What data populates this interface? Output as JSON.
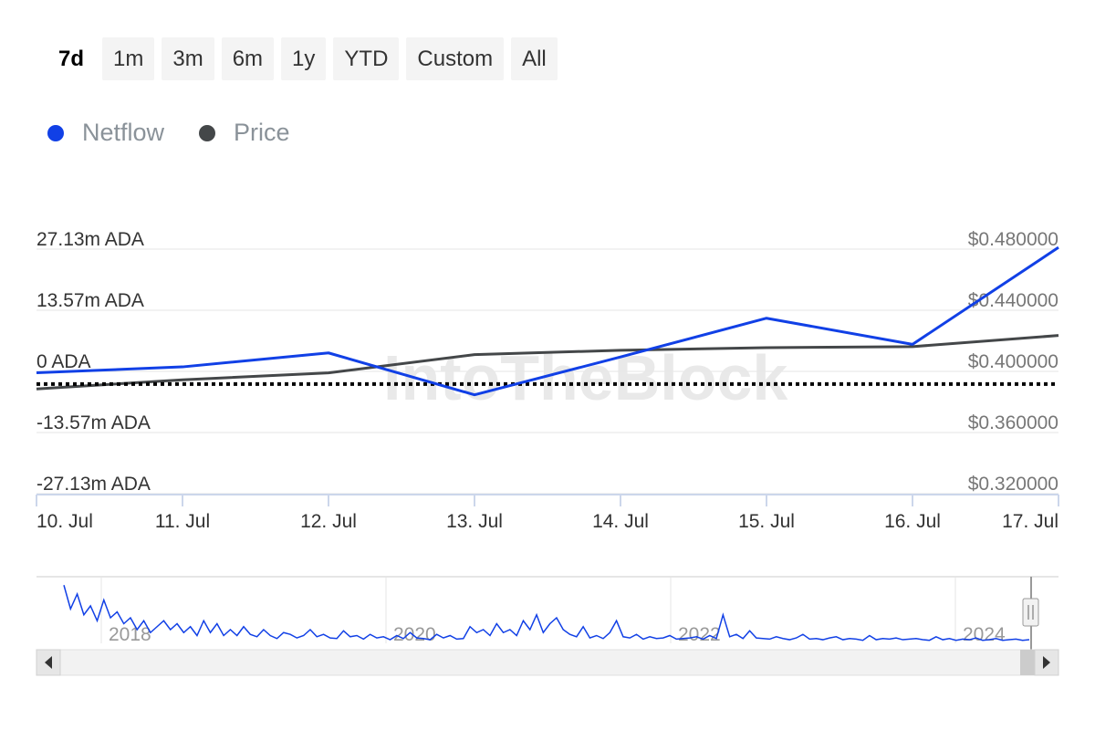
{
  "toolbar": {
    "ranges": [
      {
        "label": "7d",
        "active": true
      },
      {
        "label": "1m"
      },
      {
        "label": "3m"
      },
      {
        "label": "6m"
      },
      {
        "label": "1y"
      },
      {
        "label": "YTD"
      },
      {
        "label": "Custom"
      },
      {
        "label": "All"
      }
    ]
  },
  "legend": [
    {
      "label": "Netflow",
      "color": "#1140e6"
    },
    {
      "label": "Price",
      "color": "#444749"
    }
  ],
  "watermark": "IntoTheBlock",
  "chart_data": {
    "type": "line",
    "x": [
      "10. Jul",
      "11. Jul",
      "12. Jul",
      "13. Jul",
      "14. Jul",
      "15. Jul",
      "16. Jul",
      "17. Jul"
    ],
    "x_index": [
      0,
      1,
      2,
      3,
      4,
      5,
      6,
      7
    ],
    "series": [
      {
        "name": "Netflow",
        "axis": "left",
        "color": "#1140e6",
        "values": [
          -0.3,
          1.0,
          4.1,
          -5.2,
          3.2,
          11.8,
          6.0,
          27.5
        ]
      },
      {
        "name": "Price",
        "axis": "right",
        "color": "#444749",
        "values": [
          0.3885,
          0.3945,
          0.399,
          0.411,
          0.4138,
          0.4155,
          0.4162,
          0.4235
        ]
      }
    ],
    "left_axis": {
      "ticks": [
        "27.13m ADA",
        "13.57m ADA",
        "0 ADA",
        "-13.57m ADA",
        "-27.13m ADA"
      ],
      "values": [
        27.13,
        13.57,
        0,
        -13.57,
        -27.13
      ],
      "ylim": [
        -27.13,
        27.13
      ]
    },
    "right_axis": {
      "ticks": [
        "$0.480000",
        "$0.440000",
        "$0.400000",
        "$0.360000",
        "$0.320000"
      ],
      "values": [
        0.48,
        0.44,
        0.4,
        0.36,
        0.32
      ],
      "ylim": [
        0.32,
        0.48
      ]
    },
    "zero_line": {
      "style": "dotted",
      "color": "#000000",
      "value": -2.8
    },
    "grid": true,
    "navigator": {
      "year_labels": [
        "2018",
        "2020",
        "2022",
        "2024"
      ],
      "series": [
        0.95,
        0.55,
        0.8,
        0.45,
        0.6,
        0.35,
        0.7,
        0.4,
        0.5,
        0.3,
        0.4,
        0.2,
        0.35,
        0.15,
        0.25,
        0.35,
        0.2,
        0.3,
        0.15,
        0.25,
        0.1,
        0.35,
        0.15,
        0.3,
        0.1,
        0.2,
        0.1,
        0.25,
        0.12,
        0.08,
        0.2,
        0.1,
        0.05,
        0.15,
        0.12,
        0.06,
        0.1,
        0.2,
        0.08,
        0.12,
        0.06,
        0.05,
        0.18,
        0.08,
        0.1,
        0.04,
        0.12,
        0.06,
        0.08,
        0.03,
        0.1,
        0.05,
        0.15,
        0.06,
        0.05,
        0.03,
        0.12,
        0.06,
        0.1,
        0.04,
        0.05,
        0.25,
        0.15,
        0.2,
        0.1,
        0.3,
        0.15,
        0.2,
        0.1,
        0.35,
        0.2,
        0.45,
        0.15,
        0.3,
        0.4,
        0.2,
        0.12,
        0.08,
        0.25,
        0.06,
        0.1,
        0.05,
        0.15,
        0.35,
        0.08,
        0.06,
        0.12,
        0.04,
        0.08,
        0.05,
        0.06,
        0.1,
        0.04,
        0.05,
        0.06,
        0.08,
        0.04,
        0.1,
        0.05,
        0.45,
        0.08,
        0.12,
        0.05,
        0.18,
        0.06,
        0.05,
        0.04,
        0.08,
        0.05,
        0.03,
        0.06,
        0.12,
        0.04,
        0.05,
        0.03,
        0.06,
        0.08,
        0.03,
        0.05,
        0.04,
        0.02,
        0.1,
        0.03,
        0.05,
        0.04,
        0.06,
        0.03,
        0.04,
        0.05,
        0.03,
        0.02,
        0.08,
        0.03,
        0.05,
        0.02,
        0.04,
        0.03,
        0.06,
        0.02,
        0.03,
        0.05,
        0.02,
        0.03,
        0.04,
        0.02,
        0.03
      ]
    }
  }
}
